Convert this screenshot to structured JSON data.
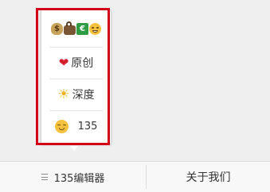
{
  "menu": {
    "items": [
      {
        "icons": [
          "money-bag-icon",
          "handbag-icon",
          "euro-bill-icon",
          "grinning-face-icon"
        ]
      },
      {
        "icon": "heart-icon",
        "label": "原创"
      },
      {
        "icon": "sun-icon",
        "label": "深度"
      },
      {
        "icon": "smiling-face-icon",
        "label": "135"
      }
    ],
    "highlight_color": "#d4001a"
  },
  "bottom_bar": {
    "tabs": [
      {
        "icon": "menu-lines-icon",
        "label": "135编辑器"
      },
      {
        "label": "关于我们"
      }
    ]
  }
}
